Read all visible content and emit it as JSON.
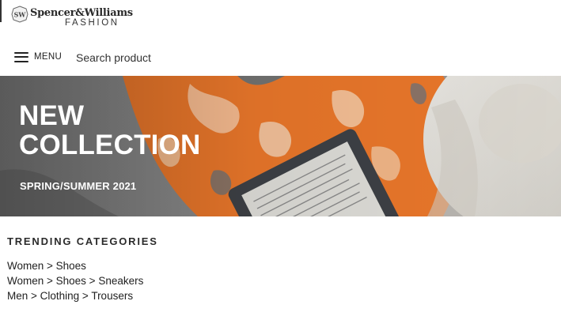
{
  "logo": {
    "badge": "SW",
    "brand": "Spencer&Williams",
    "subtitle": "FASHION"
  },
  "nav": {
    "menu_label": "MENU",
    "search_placeholder": "Search product"
  },
  "hero": {
    "title_line1": "NEW",
    "title_line2": "COLLECTION",
    "subtitle": "SPRING/SUMMER 2021"
  },
  "trending": {
    "heading": "TRENDING CATEGORIES",
    "items": [
      "Women > Shoes",
      "Women > Shoes > Sneakers",
      "Men > Clothing > Trousers"
    ]
  },
  "colors": {
    "hero_orange": "#e8762a",
    "hero_gray": "#8f8f8f",
    "text": "#222222"
  }
}
